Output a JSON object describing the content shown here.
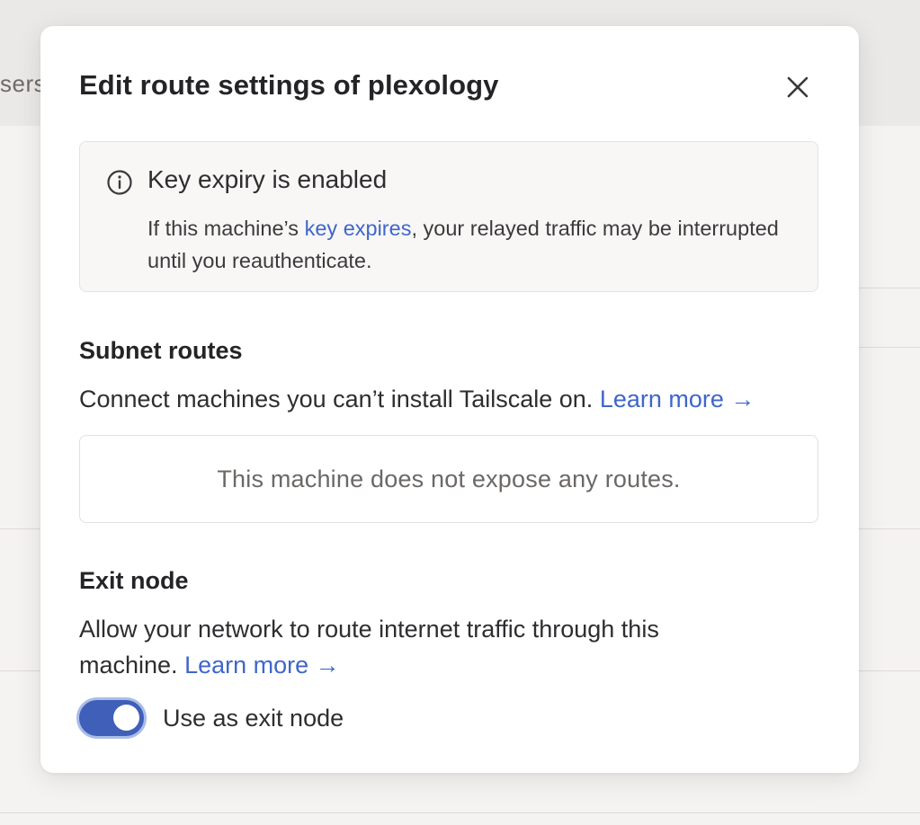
{
  "background": {
    "tab_fragment": "sers"
  },
  "modal": {
    "title": "Edit route settings of plexology",
    "close_icon": "close-icon",
    "callout": {
      "icon": "info-icon",
      "title": "Key expiry is enabled",
      "body_before": "If this machine’s ",
      "body_link": "key expires",
      "body_after": ", your relayed traffic may be interrupted until you reauthenticate."
    },
    "subnet_routes": {
      "heading": "Subnet routes",
      "description": "Connect machines you can’t install Tailscale on. ",
      "learn_more": "Learn more →",
      "empty_state": "This machine does not expose any routes."
    },
    "exit_node": {
      "heading": "Exit node",
      "description": "Allow your network to route internet traffic through this machine. ",
      "learn_more": "Learn more →",
      "toggle_label": "Use as exit node",
      "toggle_on": true
    }
  },
  "colors": {
    "accent": "#3f5fb9",
    "link": "#3f66c9"
  }
}
